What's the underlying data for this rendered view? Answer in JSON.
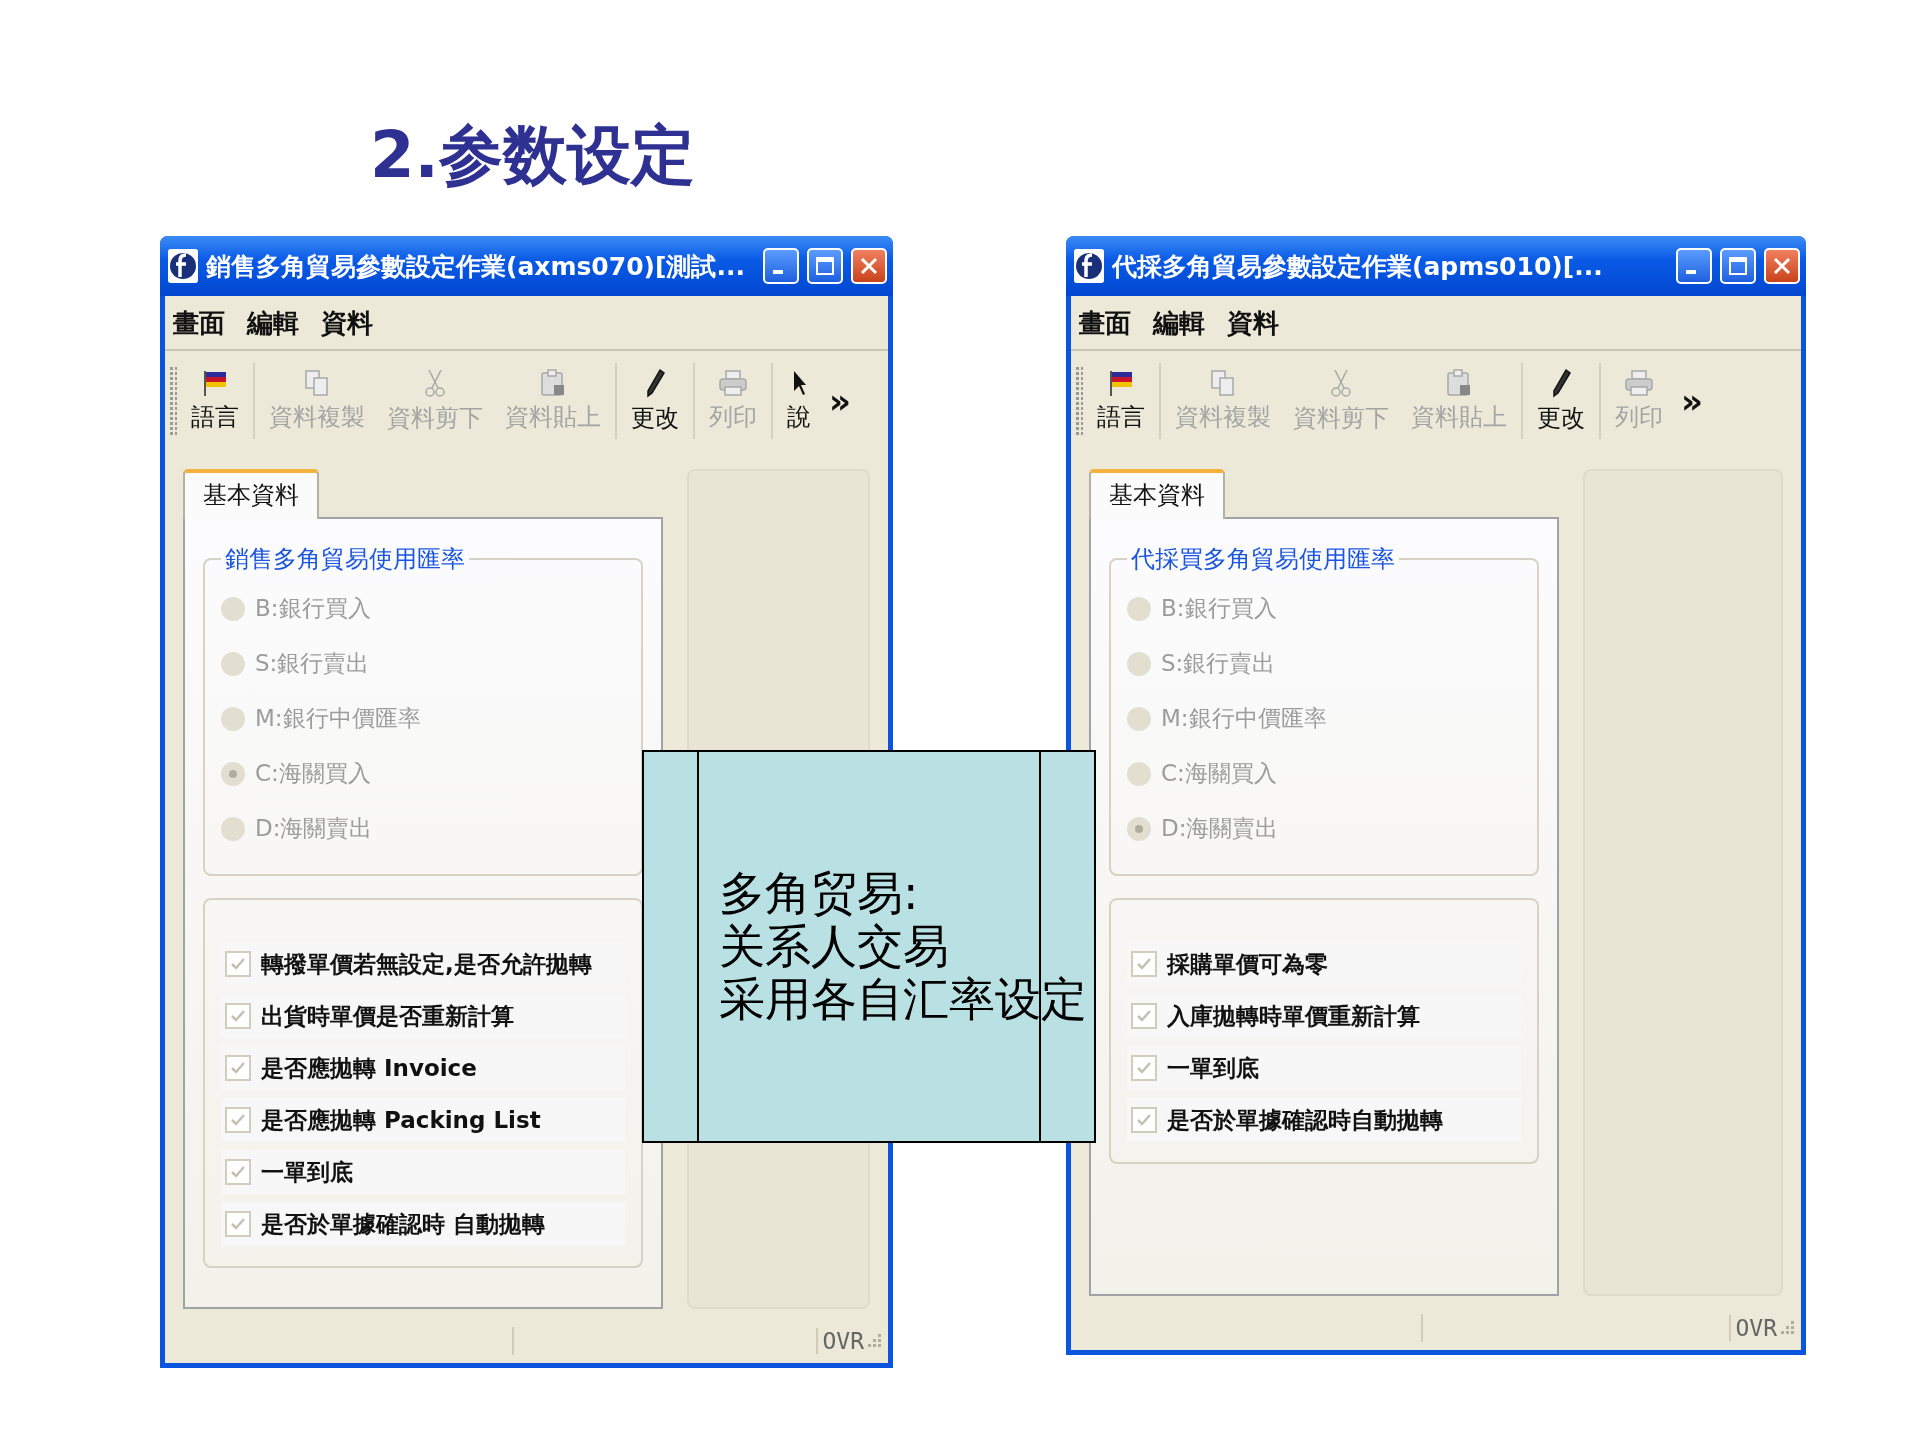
{
  "heading": "2.参数设定",
  "windows": [
    {
      "title": "銷售多角貿易參數設定作業(axms070)[測試...",
      "menu": [
        "畫面",
        "編輯",
        "資料"
      ],
      "toolbar_groups": [
        {
          "items": [
            {
              "kind": "flag",
              "label": "語言",
              "disabled": false
            }
          ]
        },
        {
          "items": [
            {
              "kind": "copy",
              "label": "資料複製",
              "disabled": true
            },
            {
              "kind": "cut",
              "label": "資料剪下",
              "disabled": true
            },
            {
              "kind": "paste",
              "label": "資料貼上",
              "disabled": true
            }
          ]
        },
        {
          "items": [
            {
              "kind": "edit",
              "label": "更改",
              "disabled": false
            }
          ]
        },
        {
          "items": [
            {
              "kind": "print",
              "label": "列印",
              "disabled": true
            }
          ]
        },
        {
          "items": [
            {
              "kind": "pointer",
              "label": "說",
              "disabled": false
            }
          ]
        }
      ],
      "overflow": "»",
      "tab": "基本資料",
      "group_title": "銷售多角貿易使用匯率",
      "radios": [
        {
          "label": "B:銀行買入",
          "selected": false
        },
        {
          "label": "S:銀行賣出",
          "selected": false
        },
        {
          "label": "M:銀行中價匯率",
          "selected": false
        },
        {
          "label": "C:海關買入",
          "selected": true
        },
        {
          "label": "D:海關賣出",
          "selected": false
        }
      ],
      "checks": [
        {
          "label": "轉撥單價若無設定,是否允許拋轉",
          "checked": true
        },
        {
          "label": "出貨時單價是否重新計算",
          "checked": true
        },
        {
          "label": "是否應拋轉 Invoice",
          "checked": true
        },
        {
          "label": "是否應拋轉 Packing List",
          "checked": true
        },
        {
          "label": "一單到底",
          "checked": true
        },
        {
          "label": "是否於單據確認時 自動拋轉",
          "checked": true
        }
      ],
      "status": "OVR"
    },
    {
      "title": "代採多角貿易參數設定作業(apms010)[...",
      "menu": [
        "畫面",
        "編輯",
        "資料"
      ],
      "toolbar_groups": [
        {
          "items": [
            {
              "kind": "flag",
              "label": "語言",
              "disabled": false
            }
          ]
        },
        {
          "items": [
            {
              "kind": "copy",
              "label": "資料複製",
              "disabled": true
            },
            {
              "kind": "cut",
              "label": "資料剪下",
              "disabled": true
            },
            {
              "kind": "paste",
              "label": "資料貼上",
              "disabled": true
            }
          ]
        },
        {
          "items": [
            {
              "kind": "edit",
              "label": "更改",
              "disabled": false
            }
          ]
        },
        {
          "items": [
            {
              "kind": "print",
              "label": "列印",
              "disabled": true
            }
          ]
        }
      ],
      "overflow": "»",
      "tab": "基本資料",
      "group_title": "代採買多角貿易使用匯率",
      "radios": [
        {
          "label": "B:銀行買入",
          "selected": false
        },
        {
          "label": "S:銀行賣出",
          "selected": false
        },
        {
          "label": "M:銀行中價匯率",
          "selected": false
        },
        {
          "label": "C:海關買入",
          "selected": false
        },
        {
          "label": "D:海關賣出",
          "selected": true
        }
      ],
      "checks": [
        {
          "label": "採購單價可為零",
          "checked": true
        },
        {
          "label": "入庫拋轉時單價重新計算",
          "checked": true
        },
        {
          "label": "一單到底",
          "checked": true
        },
        {
          "label": "是否於單據確認時自動拋轉",
          "checked": true
        }
      ],
      "status": "OVR"
    }
  ],
  "callout": {
    "lines": [
      "多角贸易:",
      "关系人交易",
      "采用各自汇率设定"
    ]
  }
}
